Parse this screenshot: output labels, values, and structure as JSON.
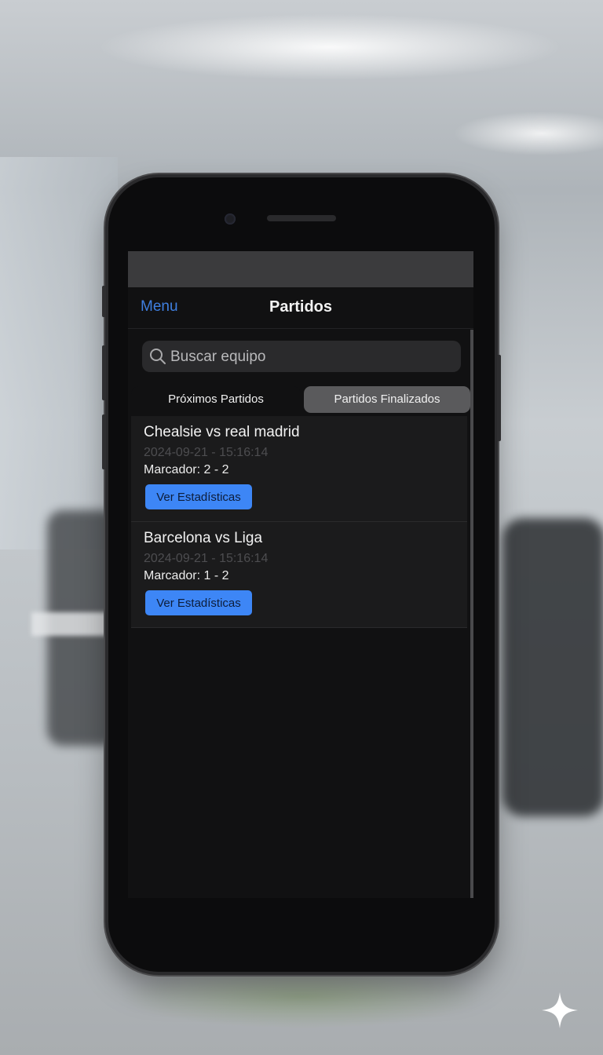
{
  "app": {
    "nav": {
      "menu_label": "Menu",
      "title": "Partidos"
    },
    "search": {
      "placeholder": "Buscar equipo",
      "icon": "search-icon"
    },
    "tabs": [
      {
        "label": "Próximos Partidos",
        "selected": false
      },
      {
        "label": "Partidos Finalizados",
        "selected": true
      }
    ],
    "matches": [
      {
        "title": "Chealsie vs real madrid",
        "datetime": "2024-09-21 - 15:16:14",
        "score": "Marcador: 2 - 2",
        "button_label": "Ver Estadísticas"
      },
      {
        "title": "Barcelona vs Liga",
        "datetime": "2024-09-21 - 15:16:14",
        "score": "Marcador: 1 - 2",
        "button_label": "Ver Estadísticas"
      }
    ]
  },
  "colors": {
    "accent": "#3d86f6",
    "menu_link": "#3f7fe0",
    "screen_bg": "#111112"
  }
}
